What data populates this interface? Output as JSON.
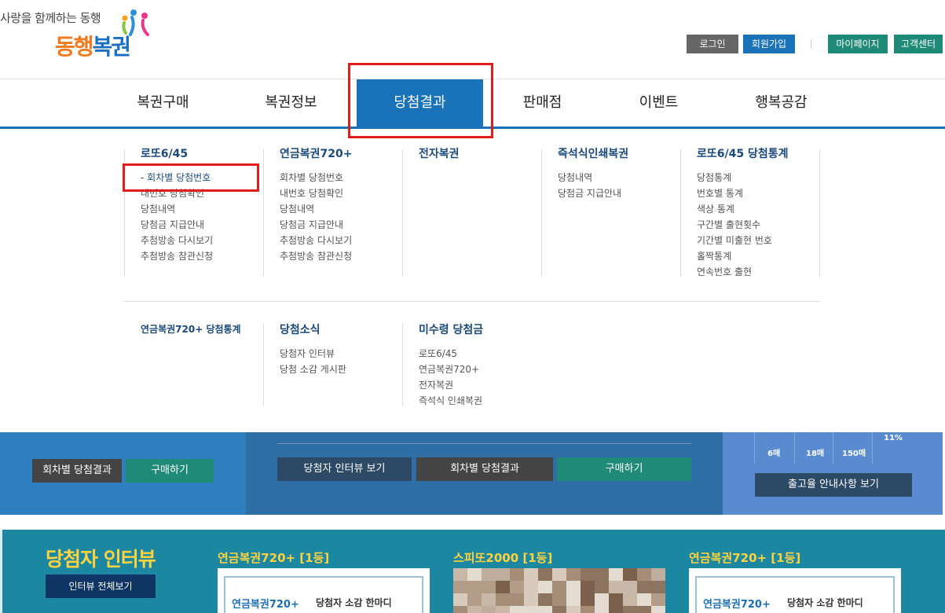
{
  "header": {
    "slogan": "사랑을 함께하는 동행",
    "logo": {
      "part1": "동행",
      "part2": "복권"
    },
    "util": {
      "login": "로그인",
      "join": "회원가입",
      "mypage": "마이페이지",
      "cs": "고객센터"
    }
  },
  "gnb": [
    {
      "label": "복권구매"
    },
    {
      "label": "복권정보"
    },
    {
      "label": "당첨결과",
      "active": true
    },
    {
      "label": "판매점"
    },
    {
      "label": "이벤트"
    },
    {
      "label": "행복공감"
    }
  ],
  "dropdown": {
    "lotto": {
      "title": "로또6/45",
      "items": [
        "회차별 당첨번호",
        "내번호 당첨확인",
        "당첨내역",
        "당첨금 지급안내",
        "추첨방송 다시보기",
        "추첨방송 참관신청"
      ]
    },
    "pension": {
      "title": "연금복권720+",
      "items": [
        "회차별 당첨번호",
        "내번호 당첨확인",
        "당첨내역",
        "당첨금 지급안내",
        "추첨방송 다시보기",
        "추첨방송 참관신청"
      ]
    },
    "e_lottery": {
      "title": "전자복권"
    },
    "instant": {
      "title": "즉석식인쇄복권",
      "items": [
        "당첨내역",
        "당첨금 지급안내"
      ]
    },
    "stats": {
      "title": "로또6/45 당첨통계",
      "items": [
        "당첨통계",
        "번호별 통계",
        "색상 통계",
        "구간별 출현횟수",
        "기간별 미출현 번호",
        "홀짝통계",
        "연속번호 출현"
      ]
    },
    "pension_stats": {
      "title": "연금복권720+ 당첨통계"
    },
    "news": {
      "title": "당첨소식",
      "items": [
        "당첨자 인터뷰",
        "당첨 소감 게시판"
      ]
    },
    "unclaimed": {
      "title": "미수령 당첨금",
      "items": [
        "로또6/45",
        "연금복권720+",
        "전자복권",
        "즉석식 인쇄복권"
      ]
    }
  },
  "banner": {
    "left": {
      "result": "회차별 당첨결과",
      "buy": "구매하기"
    },
    "mid": {
      "interview": "당첨자 인터뷰 보기",
      "result": "회차별 당첨결과",
      "buy": "구매하기"
    },
    "right": {
      "stat1": "6매",
      "stat2": "18매",
      "stat3": "150매",
      "pct": "11%",
      "notice": "출고율 안내사항 보기"
    }
  },
  "interview": {
    "title": "당첨자 인터뷰",
    "all": "인터뷰 전체보기",
    "cards": [
      {
        "title": "연금복권720+ [1등]",
        "logo": "연금복권720+",
        "caption": "당첨자 소감 한마디"
      },
      {
        "title": "스피또2000 [1등]"
      },
      {
        "title": "연금복권720+ [1등]",
        "logo": "연금복권720+",
        "caption": "당첨자 소감 한마디"
      }
    ]
  },
  "colors": {
    "primary": "#1a73b8",
    "teal": "#1f8a78",
    "highlight": "#e21b1b"
  }
}
